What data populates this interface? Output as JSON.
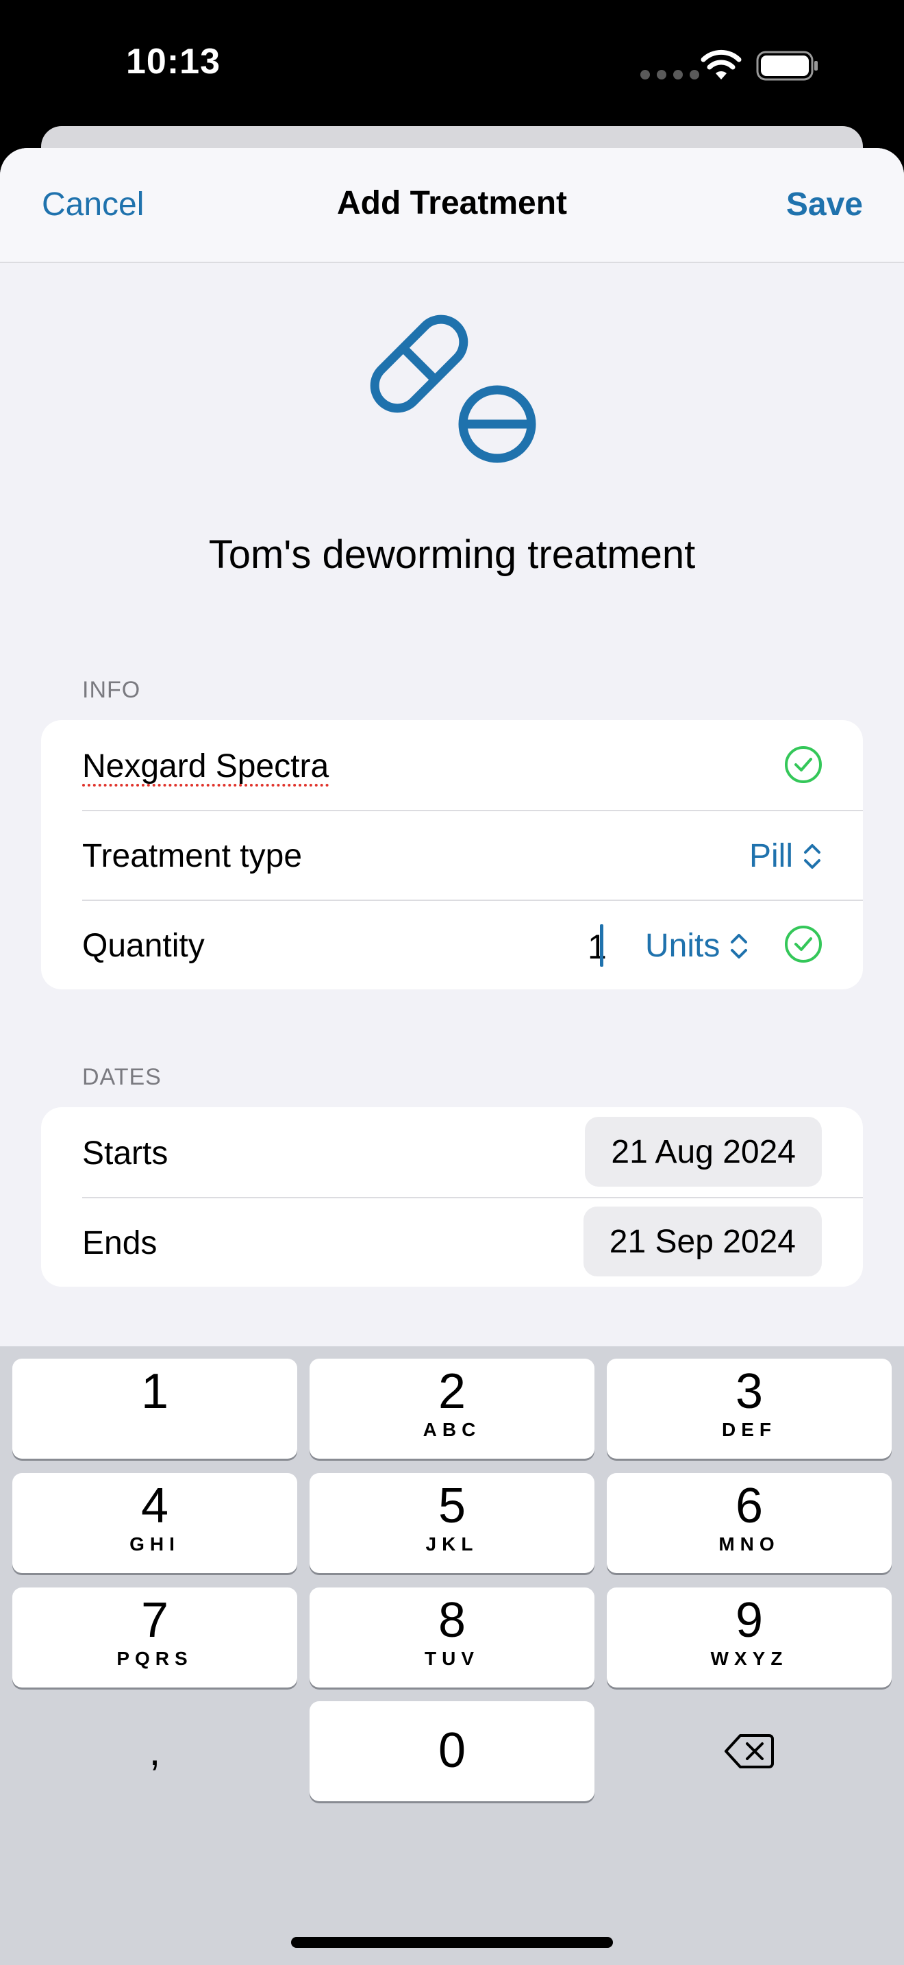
{
  "status_bar": {
    "time": "10:13"
  },
  "navbar": {
    "cancel_label": "Cancel",
    "title": "Add Treatment",
    "save_label": "Save"
  },
  "header": {
    "icon": "pills-icon",
    "treatment_title": "Tom's deworming treatment"
  },
  "info": {
    "section_title": "INFO",
    "medication_name": "Nexgard Spectra",
    "treatment_type_label": "Treatment type",
    "treatment_type_value": "Pill",
    "quantity_label": "Quantity",
    "quantity_value": "1",
    "quantity_unit": "Units"
  },
  "dates": {
    "section_title": "DATES",
    "starts_label": "Starts",
    "starts_value": "21 Aug 2024",
    "ends_label": "Ends",
    "ends_value": "21 Sep 2024"
  },
  "keyboard": {
    "keys": [
      {
        "num": "1",
        "letters": ""
      },
      {
        "num": "2",
        "letters": "ABC"
      },
      {
        "num": "3",
        "letters": "DEF"
      },
      {
        "num": "4",
        "letters": "GHI"
      },
      {
        "num": "5",
        "letters": "JKL"
      },
      {
        "num": "6",
        "letters": "MNO"
      },
      {
        "num": "7",
        "letters": "PQRS"
      },
      {
        "num": "8",
        "letters": "TUV"
      },
      {
        "num": "9",
        "letters": "WXYZ"
      },
      {
        "num": "0",
        "letters": ""
      }
    ],
    "comma_label": ","
  },
  "colors": {
    "accent": "#1f72ad",
    "valid": "#34c759",
    "background": "#f2f2f7"
  }
}
